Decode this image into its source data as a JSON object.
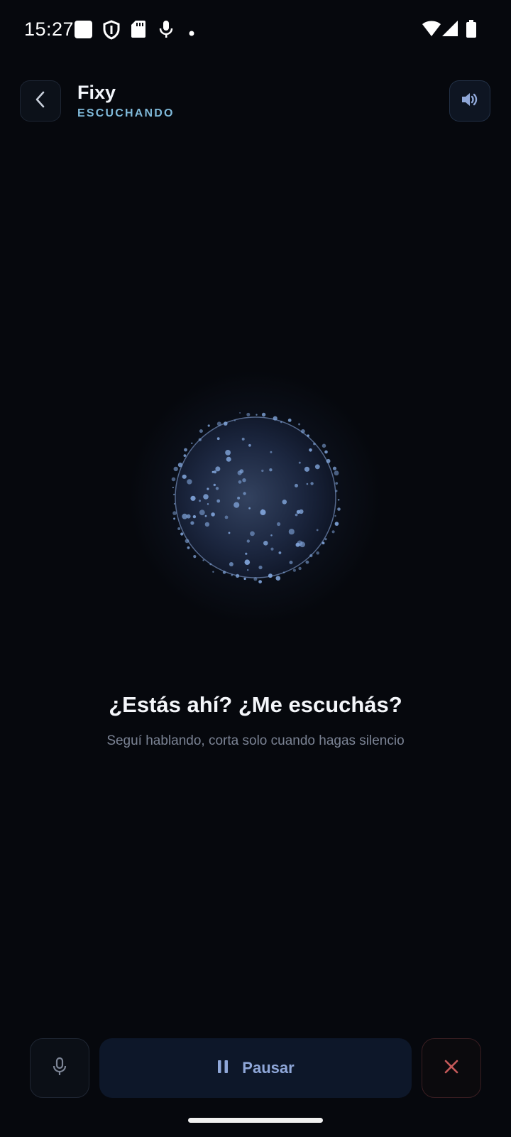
{
  "status_bar": {
    "time": "15:27",
    "icons_left": [
      "notification-square-icon",
      "shield-icon",
      "sd-card-icon",
      "mic-icon",
      "dot-icon"
    ],
    "icons_right": [
      "wifi-icon",
      "cellular-signal-icon",
      "battery-icon"
    ]
  },
  "header": {
    "title": "Fixy",
    "status": "ESCUCHANDO",
    "back_icon": "chevron-left-icon",
    "volume_icon": "volume-icon"
  },
  "orb": {
    "state": "listening",
    "colors": {
      "core": "#2f3f63",
      "dots": "#7fa3d8",
      "ring": "#5c6f92"
    }
  },
  "message": {
    "prompt": "¿Estás ahí? ¿Me escuchás?",
    "hint": "Seguí hablando, corta solo cuando hagas silencio"
  },
  "controls": {
    "mic_icon": "mic-icon",
    "pause_icon": "pause-icon",
    "pause_label": "Pausar",
    "close_icon": "close-icon"
  },
  "colors": {
    "background": "#06080d",
    "accent": "#8fa7d8",
    "status_text": "#7fb9d9",
    "close": "#c65a5a"
  }
}
